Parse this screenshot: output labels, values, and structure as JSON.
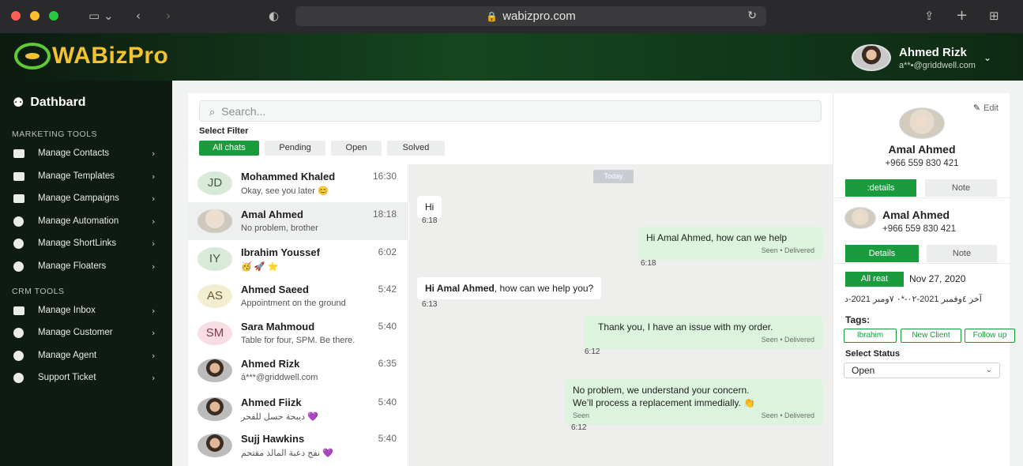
{
  "browser": {
    "url": "wabizpro.com"
  },
  "brand": {
    "name": "WABizPro",
    "accent": "#1a9c3e",
    "logo_color": "#f2c230"
  },
  "user": {
    "name": "Ahmed Rizk",
    "email": "a**•@griddwell.com"
  },
  "sidebar": {
    "title": "Dathbard",
    "sections": [
      {
        "label": "MARKETING TOOLS",
        "items": [
          {
            "label": "Manage Contacts",
            "icon": "contacts-icon"
          },
          {
            "label": "Manage Templates",
            "icon": "templates-icon"
          },
          {
            "label": "Manage Campaigns",
            "icon": "campaigns-icon"
          },
          {
            "label": "Manage Automation",
            "icon": "automation-icon"
          },
          {
            "label": "Manage ShortLinks",
            "icon": "shortlinks-icon"
          },
          {
            "label": "Manage Floaters",
            "icon": "floaters-icon"
          }
        ]
      },
      {
        "label": "CRM TOOLS",
        "items": [
          {
            "label": "Manage Inbox",
            "icon": "inbox-icon"
          },
          {
            "label": "Manage Customer",
            "icon": "customer-icon"
          },
          {
            "label": "Manage Agent",
            "icon": "agent-icon"
          },
          {
            "label": "Support Ticket",
            "icon": "ticket-icon"
          }
        ]
      }
    ]
  },
  "search": {
    "placeholder": "Search..."
  },
  "filter": {
    "label": "Select Filter",
    "options": [
      "All chats",
      "Pending",
      "Open",
      "Solved"
    ],
    "selected": "All chats"
  },
  "chats": [
    {
      "initials": "JD",
      "name": "Mohammed Khaled",
      "time": "16:30",
      "preview": "Okay, see you later 😊"
    },
    {
      "initials": "",
      "name": "Amal Ahmed",
      "time": "18:18",
      "preview": "No problem, brother"
    },
    {
      "initials": "IY",
      "name": "Ibrahim Youssef",
      "time": "6:02",
      "preview": "🥳 🚀 ⭐"
    },
    {
      "initials": "AS",
      "name": "Ahmed Saeed",
      "time": "5:42",
      "preview": "Appointment on the ground"
    },
    {
      "initials": "SM",
      "name": "Sara Mahmoud",
      "time": "5:40",
      "preview": "Table for four, SPM. Be there."
    },
    {
      "initials": "",
      "name": "Ahmed Rizk",
      "time": "6:35",
      "preview": "á***@griddwell.com"
    },
    {
      "initials": "",
      "name": "Ahmed Fiizk",
      "time": "5:40",
      "preview": "ديبحة حسل للفحر 💜"
    },
    {
      "initials": "",
      "name": "Sujj Hawkins",
      "time": "5:40",
      "preview": "نفج دعبة المالذ مقتحم 💜"
    }
  ],
  "conversation": {
    "day": "Today",
    "messages": [
      {
        "dir": "in",
        "text": "Hi",
        "time": "6:18"
      },
      {
        "dir": "out",
        "text": "Hi Amal Ahmed, how can we help",
        "status": "Seen • Delivered",
        "time": "6:18"
      },
      {
        "dir": "in",
        "text_bold": "Hi Amal Ahmed",
        "text_rest": ", how can we help you?",
        "time": "6:13"
      },
      {
        "dir": "out",
        "text": "Thank you, I have an issue with my order.",
        "status": "Seen • Delivered",
        "time": "6:12"
      },
      {
        "dir": "out",
        "line1": "No problem, we understand your concern.",
        "line2": "We’ll process a replacement immedially. 👏",
        "seen_left": "Seen",
        "status": "Seen • Delivered",
        "time": "6:12"
      }
    ]
  },
  "contact": {
    "edit_label": "Edit",
    "name": "Amal Ahmed",
    "phone": "+966 559 830 421",
    "tabs_top": [
      ":details",
      "Note"
    ],
    "tabs_bottom": [
      "Details",
      "Note"
    ],
    "all_read_label": "All reat",
    "date": "Nov 27, 2020",
    "arabic_line": "آخر ٤وفمبر 2021-٠٢-*٠ ٧ومبر 2021-د",
    "tags_label": "Tags:",
    "tags": [
      "Ibrahim",
      "New Client",
      "Follow up"
    ],
    "status_label": "Select Status",
    "status_value": "Open"
  }
}
